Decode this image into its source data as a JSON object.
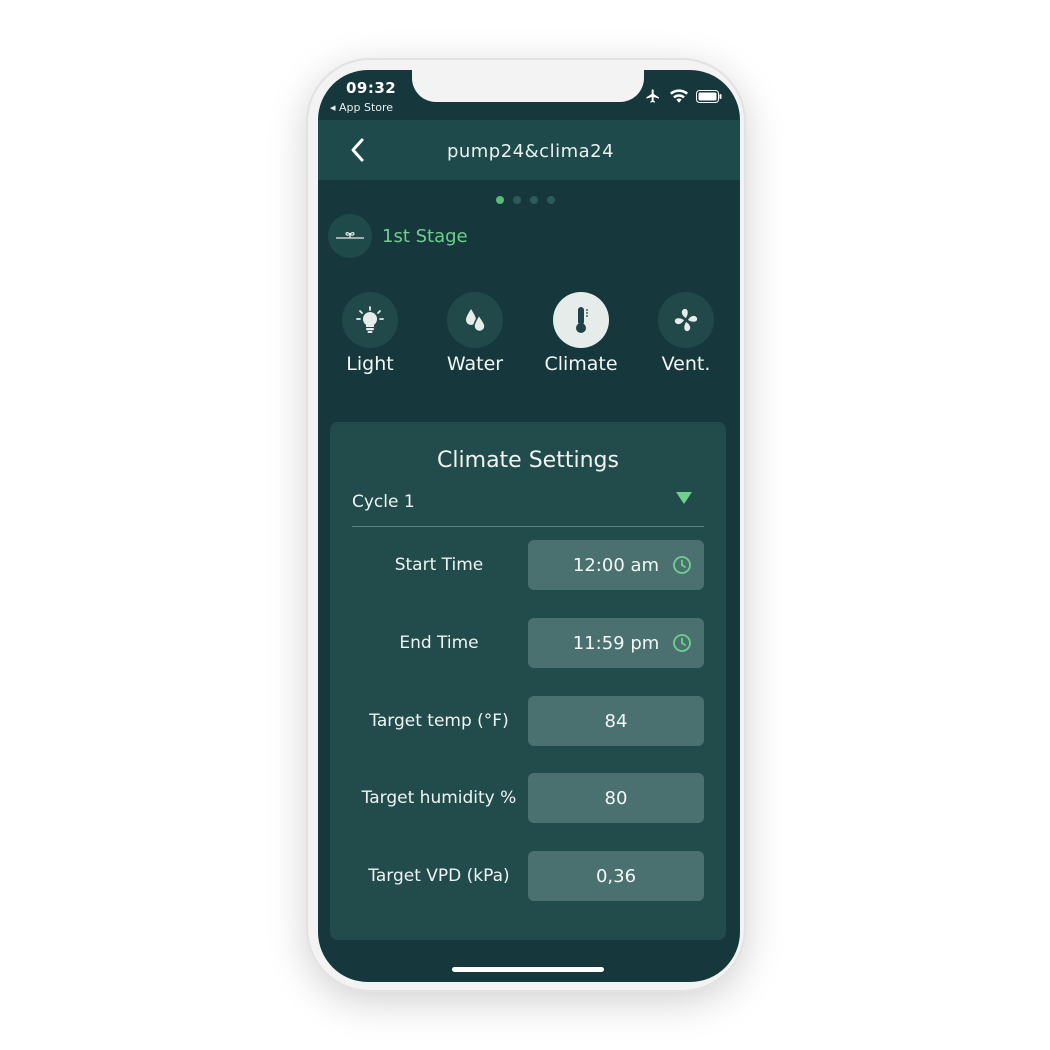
{
  "status_bar": {
    "time": "09:32",
    "back_app": "◂ App Store"
  },
  "nav": {
    "title": "pump24&clima24"
  },
  "pager": {
    "total": 4,
    "active": 1
  },
  "stage": {
    "label": "1st Stage"
  },
  "tabs": [
    {
      "label": "Light",
      "icon": "lightbulb-icon"
    },
    {
      "label": "Water",
      "icon": "water-drops-icon"
    },
    {
      "label": "Climate",
      "icon": "thermometer-icon",
      "active": true
    },
    {
      "label": "Vent.",
      "icon": "fan-icon"
    }
  ],
  "settings": {
    "title": "Climate Settings",
    "cycle": "Cycle 1",
    "rows": [
      {
        "label": "Start Time",
        "value": "12:00 am",
        "icon": "clock-icon"
      },
      {
        "label": "End Time",
        "value": "11:59 pm",
        "icon": "clock-icon"
      },
      {
        "label": "Target temp (°F)",
        "value": "84"
      },
      {
        "label": "Target humidity %",
        "value": "80"
      },
      {
        "label": "Target VPD (kPa)",
        "value": "0,36"
      }
    ]
  },
  "colors": {
    "background": "#16383c",
    "header": "#1e4a4b",
    "card": "#224b4c",
    "field": "#4a7170",
    "accent": "#6fd08e"
  }
}
